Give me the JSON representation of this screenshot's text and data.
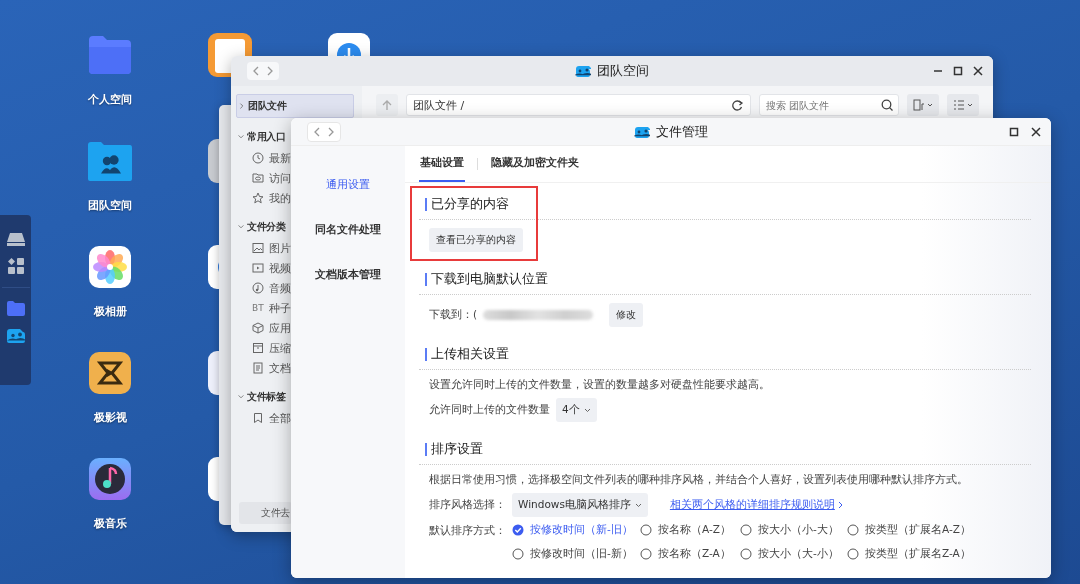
{
  "desktop": {
    "icons": [
      {
        "label": "个人空间",
        "kind": "folder"
      },
      {
        "label": "团队空间",
        "kind": "team-folder"
      },
      {
        "label": "极相册",
        "kind": "photos"
      },
      {
        "label": "极影视",
        "kind": "video"
      },
      {
        "label": "极音乐",
        "kind": "music"
      }
    ]
  },
  "team_window": {
    "title": "团队空间",
    "path": "团队文件 /",
    "search": {
      "placeholder": "搜索 团队文件"
    },
    "sidebar": {
      "items": [
        {
          "label": "团队文件",
          "selected": true,
          "expanded": false
        },
        {
          "label": "常用入口",
          "selected": false,
          "expanded": true,
          "children": [
            {
              "label": "最新",
              "kind": "clock",
              "selected": false
            },
            {
              "label": "访问",
              "kind": "eye-folder",
              "selected": false
            },
            {
              "label": "我的",
              "kind": "star",
              "selected": false
            }
          ]
        },
        {
          "label": "文件分类",
          "selected": false,
          "expanded": true,
          "children": [
            {
              "label": "图片",
              "kind": "image",
              "selected": false
            },
            {
              "label": "视频",
              "kind": "video",
              "selected": false
            },
            {
              "label": "音频",
              "kind": "audio",
              "selected": false
            },
            {
              "label": "种子",
              "kind": "text",
              "icon_text": "BT",
              "selected": false
            },
            {
              "label": "应用",
              "kind": "box",
              "selected": false
            },
            {
              "label": "压缩",
              "kind": "archive",
              "selected": false
            },
            {
              "label": "文档",
              "kind": "doc",
              "selected": false
            }
          ]
        },
        {
          "label": "文件标签",
          "selected": false,
          "expanded": true,
          "children": [
            {
              "label": "全部",
              "kind": "bookmark",
              "selected": false
            }
          ]
        }
      ]
    },
    "footer_button": "文件去"
  },
  "settings_window": {
    "title": "文件管理",
    "nav": [
      {
        "label": "通用设置",
        "selected": true
      },
      {
        "label": "同名文件处理",
        "selected": false
      },
      {
        "label": "文档版本管理",
        "selected": false
      }
    ],
    "tabs": [
      {
        "label": "基础设置",
        "selected": true
      },
      {
        "label": "隐藏及加密文件夹",
        "selected": false
      }
    ],
    "sections": [
      {
        "title": "已分享的内容",
        "highlighted": true,
        "button": "查看已分享的内容"
      },
      {
        "title": "下载到电脑默认位置",
        "highlighted": false,
        "label": "下载到：(",
        "button": "修改"
      },
      {
        "title": "上传相关设置",
        "highlighted": false,
        "description": "设置允许同时上传的文件数量，设置的数量越多对硬盘性能要求越高。",
        "label": "允许同时上传的文件数量",
        "select": "4个"
      },
      {
        "title": "排序设置",
        "highlighted": false,
        "description": "根据日常使用习惯，选择极空间文件列表的哪种排序风格，并结合个人喜好，设置列表使用哪种默认排序方式。",
        "label": "排序风格选择：",
        "select": "Windows电脑风格排序",
        "link": "相关两个风格的详细排序规则说明",
        "radio_label": "默认排序方式：",
        "options": [
          {
            "label": "按修改时间（新-旧）",
            "selected": true
          },
          {
            "label": "按名称（A-Z）",
            "selected": false
          },
          {
            "label": "按大小（小-大）",
            "selected": false
          },
          {
            "label": "按类型（扩展名A-Z）",
            "selected": false
          },
          {
            "label": "按修改时间（旧-新）",
            "selected": false
          },
          {
            "label": "按名称（Z-A）",
            "selected": false
          },
          {
            "label": "按大小（大-小）",
            "selected": false
          },
          {
            "label": "按类型（扩展名Z-A）",
            "selected": false
          }
        ]
      }
    ]
  }
}
